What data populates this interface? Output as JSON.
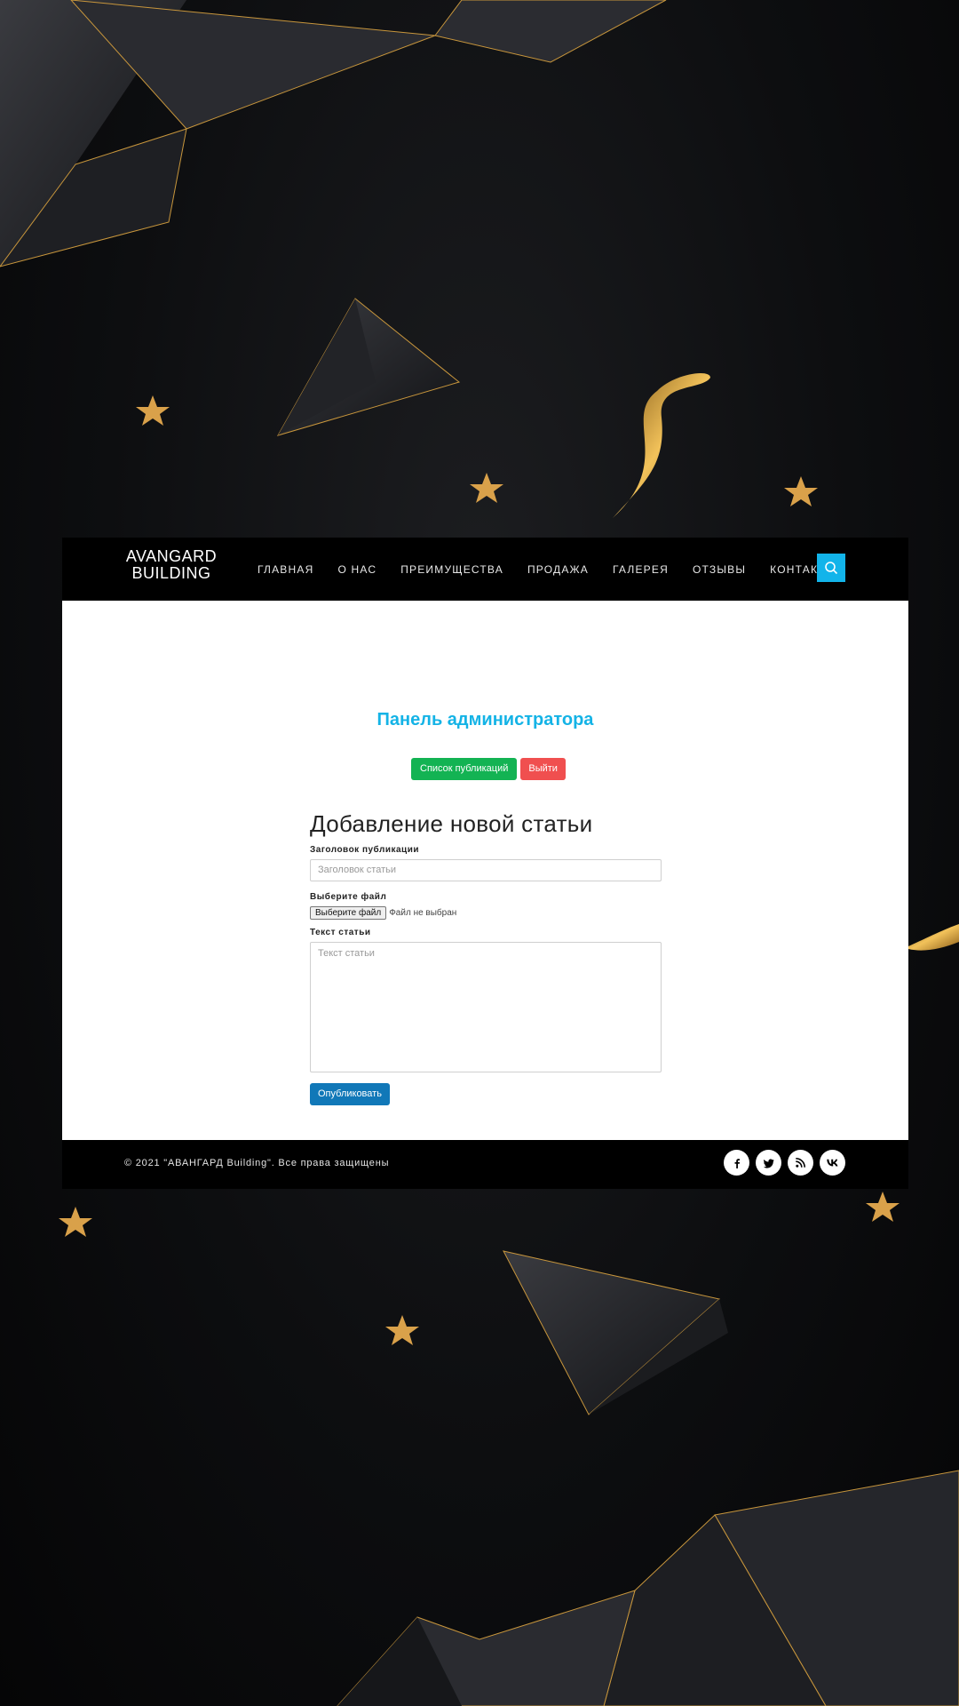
{
  "brand": {
    "line1": "AVANGARD",
    "line2": "BUILDING"
  },
  "nav": {
    "items": [
      {
        "label": "ГЛАВНАЯ"
      },
      {
        "label": "О НАС"
      },
      {
        "label": "ПРЕИМУЩЕСТВА"
      },
      {
        "label": "ПРОДАЖА"
      },
      {
        "label": "ГАЛЕРЕЯ"
      },
      {
        "label": "ОТЗЫВЫ"
      },
      {
        "label": "КОНТАКТЫ"
      }
    ],
    "search_icon": "search-icon"
  },
  "admin": {
    "title": "Панель администратора",
    "list_button": "Список публикаций",
    "logout_button": "Выйти"
  },
  "form": {
    "heading": "Добавление новой статьи",
    "title_label": "Заголовок публикации",
    "title_placeholder": "Заголовок статьи",
    "file_label": "Выберите файл",
    "file_button": "Выберите файл",
    "file_status": "Файл не выбран",
    "text_label": "Текст статьи",
    "text_placeholder": "Текст статьи",
    "submit": "Опубликовать"
  },
  "footer": {
    "copyright": "© 2021 \"АВАНГАРД Building\". Все права защищены",
    "socials": [
      {
        "icon": "facebook-icon",
        "glyph": "f"
      },
      {
        "icon": "twitter-icon",
        "glyph": "t"
      },
      {
        "icon": "rss-icon",
        "glyph": "rss"
      },
      {
        "icon": "vk-icon",
        "glyph": "vk"
      }
    ]
  },
  "colors": {
    "accent": "#14b3e6",
    "success": "#13b353",
    "danger": "#f04f4f",
    "primary": "#1178b8",
    "gold": "#d9a14a"
  }
}
